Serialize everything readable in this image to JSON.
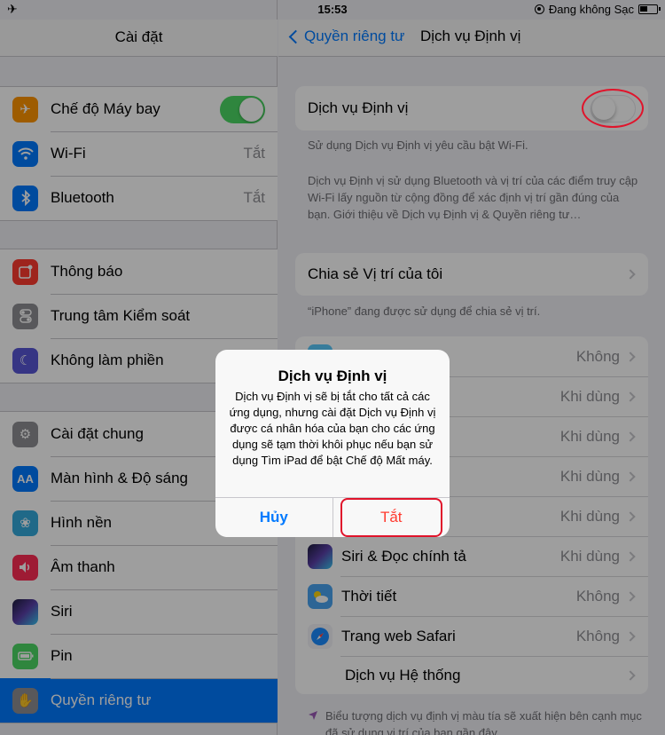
{
  "status_bar": {
    "time": "15:53",
    "charging_text": "Đang không Sạc",
    "icons": [
      "airplane-icon",
      "orientation-lock-icon",
      "battery-icon"
    ]
  },
  "left": {
    "title": "Cài đặt",
    "groups": [
      [
        {
          "label": "Chế độ Máy bay",
          "icon": "airplane-icon",
          "color": "#ff9500",
          "toggle": true
        },
        {
          "label": "Wi-Fi",
          "icon": "wifi-icon",
          "color": "#007aff",
          "value": "Tắt"
        },
        {
          "label": "Bluetooth",
          "icon": "bluetooth-icon",
          "color": "#007aff",
          "value": "Tắt"
        }
      ],
      [
        {
          "label": "Thông báo",
          "icon": "notification-icon",
          "color": "#ff3b30"
        },
        {
          "label": "Trung tâm Kiểm soát",
          "icon": "control-center-icon",
          "color": "#8e8e93"
        },
        {
          "label": "Không làm phiền",
          "icon": "moon-icon",
          "color": "#5856d6"
        }
      ],
      [
        {
          "label": "Cài đặt chung",
          "icon": "gear-icon",
          "color": "#8e8e93"
        },
        {
          "label": "Màn hình & Độ sáng",
          "icon": "text-size-icon",
          "color": "#007aff"
        },
        {
          "label": "Hình nền",
          "icon": "wallpaper-icon",
          "color": "#34aadc"
        },
        {
          "label": "Âm thanh",
          "icon": "speaker-icon",
          "color": "#ff2d55"
        },
        {
          "label": "Siri",
          "icon": "siri-icon",
          "color": "#1c1c3c"
        },
        {
          "label": "Pin",
          "icon": "battery-icon",
          "color": "#4cd964"
        },
        {
          "label": "Quyền riêng tư",
          "icon": "hand-icon",
          "color": "#8e8e93",
          "selected": true
        }
      ]
    ]
  },
  "right": {
    "back_label": "Quyền riêng tư",
    "title": "Dịch vụ Định vị",
    "location_services_label": "Dịch vụ Định vị",
    "location_services_on": false,
    "note_wifi": "Sử dụng Dịch vụ Định vị yêu cầu bật Wi-Fi.",
    "note_about": "Dịch vụ Định vị sử dụng Bluetooth và vị trí của các điểm truy cập Wi-Fi lấy nguồn từ cộng đồng để xác định vị trí gần đúng của bạn. Giới thiệu về Dịch vụ Định vị & Quyền riêng tư…",
    "share_label": "Chia sẻ Vị trí của tôi",
    "share_note": "“iPhone” đang được sử dụng để chia sẻ vị trí.",
    "apps": [
      {
        "name": "",
        "value": "Không",
        "icon": "app-icon",
        "color": "#5ac8fa"
      },
      {
        "name": "",
        "value": "Khi dùng",
        "icon": "app-icon",
        "color": "#ffffff"
      },
      {
        "name": "",
        "value": "Khi dùng",
        "icon": "app-icon",
        "color": "#ffffff"
      },
      {
        "name": "",
        "value": "Khi dùng",
        "icon": "app-icon",
        "color": "#ffffff"
      },
      {
        "name": "",
        "value": "Khi dùng",
        "icon": "app-icon",
        "color": "#ffffff"
      },
      {
        "name": "Siri & Đọc chính tả",
        "value": "Khi dùng",
        "icon": "siri-icon",
        "color": "#1c1c3c"
      },
      {
        "name": "Thời tiết",
        "value": "Không",
        "icon": "weather-icon",
        "color": "#4aa3f0"
      },
      {
        "name": "Trang web Safari",
        "value": "Không",
        "icon": "safari-icon",
        "color": "#f2f2f7"
      },
      {
        "name": "Dịch vụ Hệ thống",
        "value": "",
        "icon": "",
        "color": ""
      }
    ],
    "footer_note": "Biểu tượng dịch vụ định vị màu tía sẽ xuất hiện bên cạnh mục đã sử dụng vị trí của bạn gần đây."
  },
  "alert": {
    "title": "Dịch vụ Định vị",
    "message": "Dịch vụ Định vị sẽ bị tắt cho tất cả các ứng dụng, nhưng cài đặt Dịch vụ Định vị được cá nhân hóa của bạn cho các ứng dụng sẽ tạm thời khôi phục nếu bạn sử dụng Tìm iPad để bật Chế độ Mất máy.",
    "cancel": "Hủy",
    "confirm": "Tắt"
  },
  "colors": {
    "accent": "#007aff",
    "destructive": "#ff3b30",
    "highlight": "#e0142b",
    "toggle_on": "#4cd964"
  }
}
